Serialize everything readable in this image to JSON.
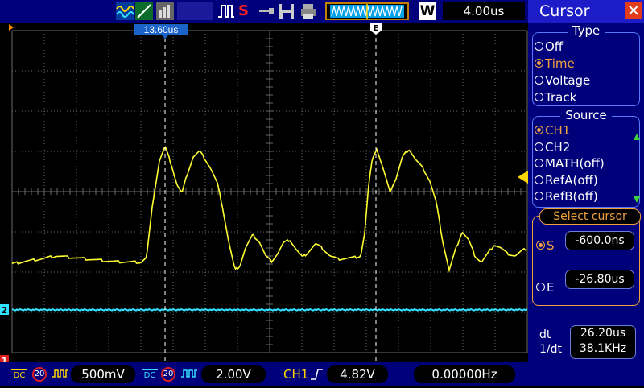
{
  "top_bar": {
    "acquire_icon": "wave-icon",
    "trigger_state_icon": "run-icon",
    "stop_label": "S",
    "timebase": "4.00us",
    "window_label": "W"
  },
  "plot": {
    "cursor_a_readout": "13.60us",
    "cursor_b_label": "E",
    "ch2_marker": "2",
    "ch1_marker": "1",
    "colors": {
      "ch1": "#ffff33",
      "ch2": "#33e0ff",
      "grid": "#6a6a6a",
      "trigger": "#ffd700"
    }
  },
  "bottom_bar": {
    "ch1": {
      "coupling": "DC",
      "bw_limit": "20",
      "volts_div": "500mV"
    },
    "ch2": {
      "coupling": "DC",
      "bw_limit": "20",
      "volts_div": "2.00V"
    },
    "trigger_source": "CH1",
    "trigger_level": "4.82V",
    "frequency": "0.00000Hz"
  },
  "panel": {
    "title": "Cursor",
    "type_group": {
      "label": "Type",
      "options": [
        {
          "label": "Off",
          "selected": false
        },
        {
          "label": "Time",
          "selected": true
        },
        {
          "label": "Voltage",
          "selected": false
        },
        {
          "label": "Track",
          "selected": false
        }
      ]
    },
    "source_group": {
      "label": "Source",
      "options": [
        {
          "label": "CH1",
          "selected": true
        },
        {
          "label": "CH2",
          "selected": false
        },
        {
          "label": "MATH(off)",
          "selected": false
        },
        {
          "label": "RefA(off)",
          "selected": false
        },
        {
          "label": "RefB(off)",
          "selected": false
        }
      ]
    },
    "select_cursor": {
      "label": "Select cursor",
      "s_label": "S",
      "s_value": "-600.0ns",
      "e_label": "E",
      "e_value": "-26.80us"
    },
    "readout": {
      "dt_label": "dt",
      "dt_value": "26.20us",
      "inv_dt_label": "1/dt",
      "inv_dt_value": "38.1KHz"
    }
  }
}
